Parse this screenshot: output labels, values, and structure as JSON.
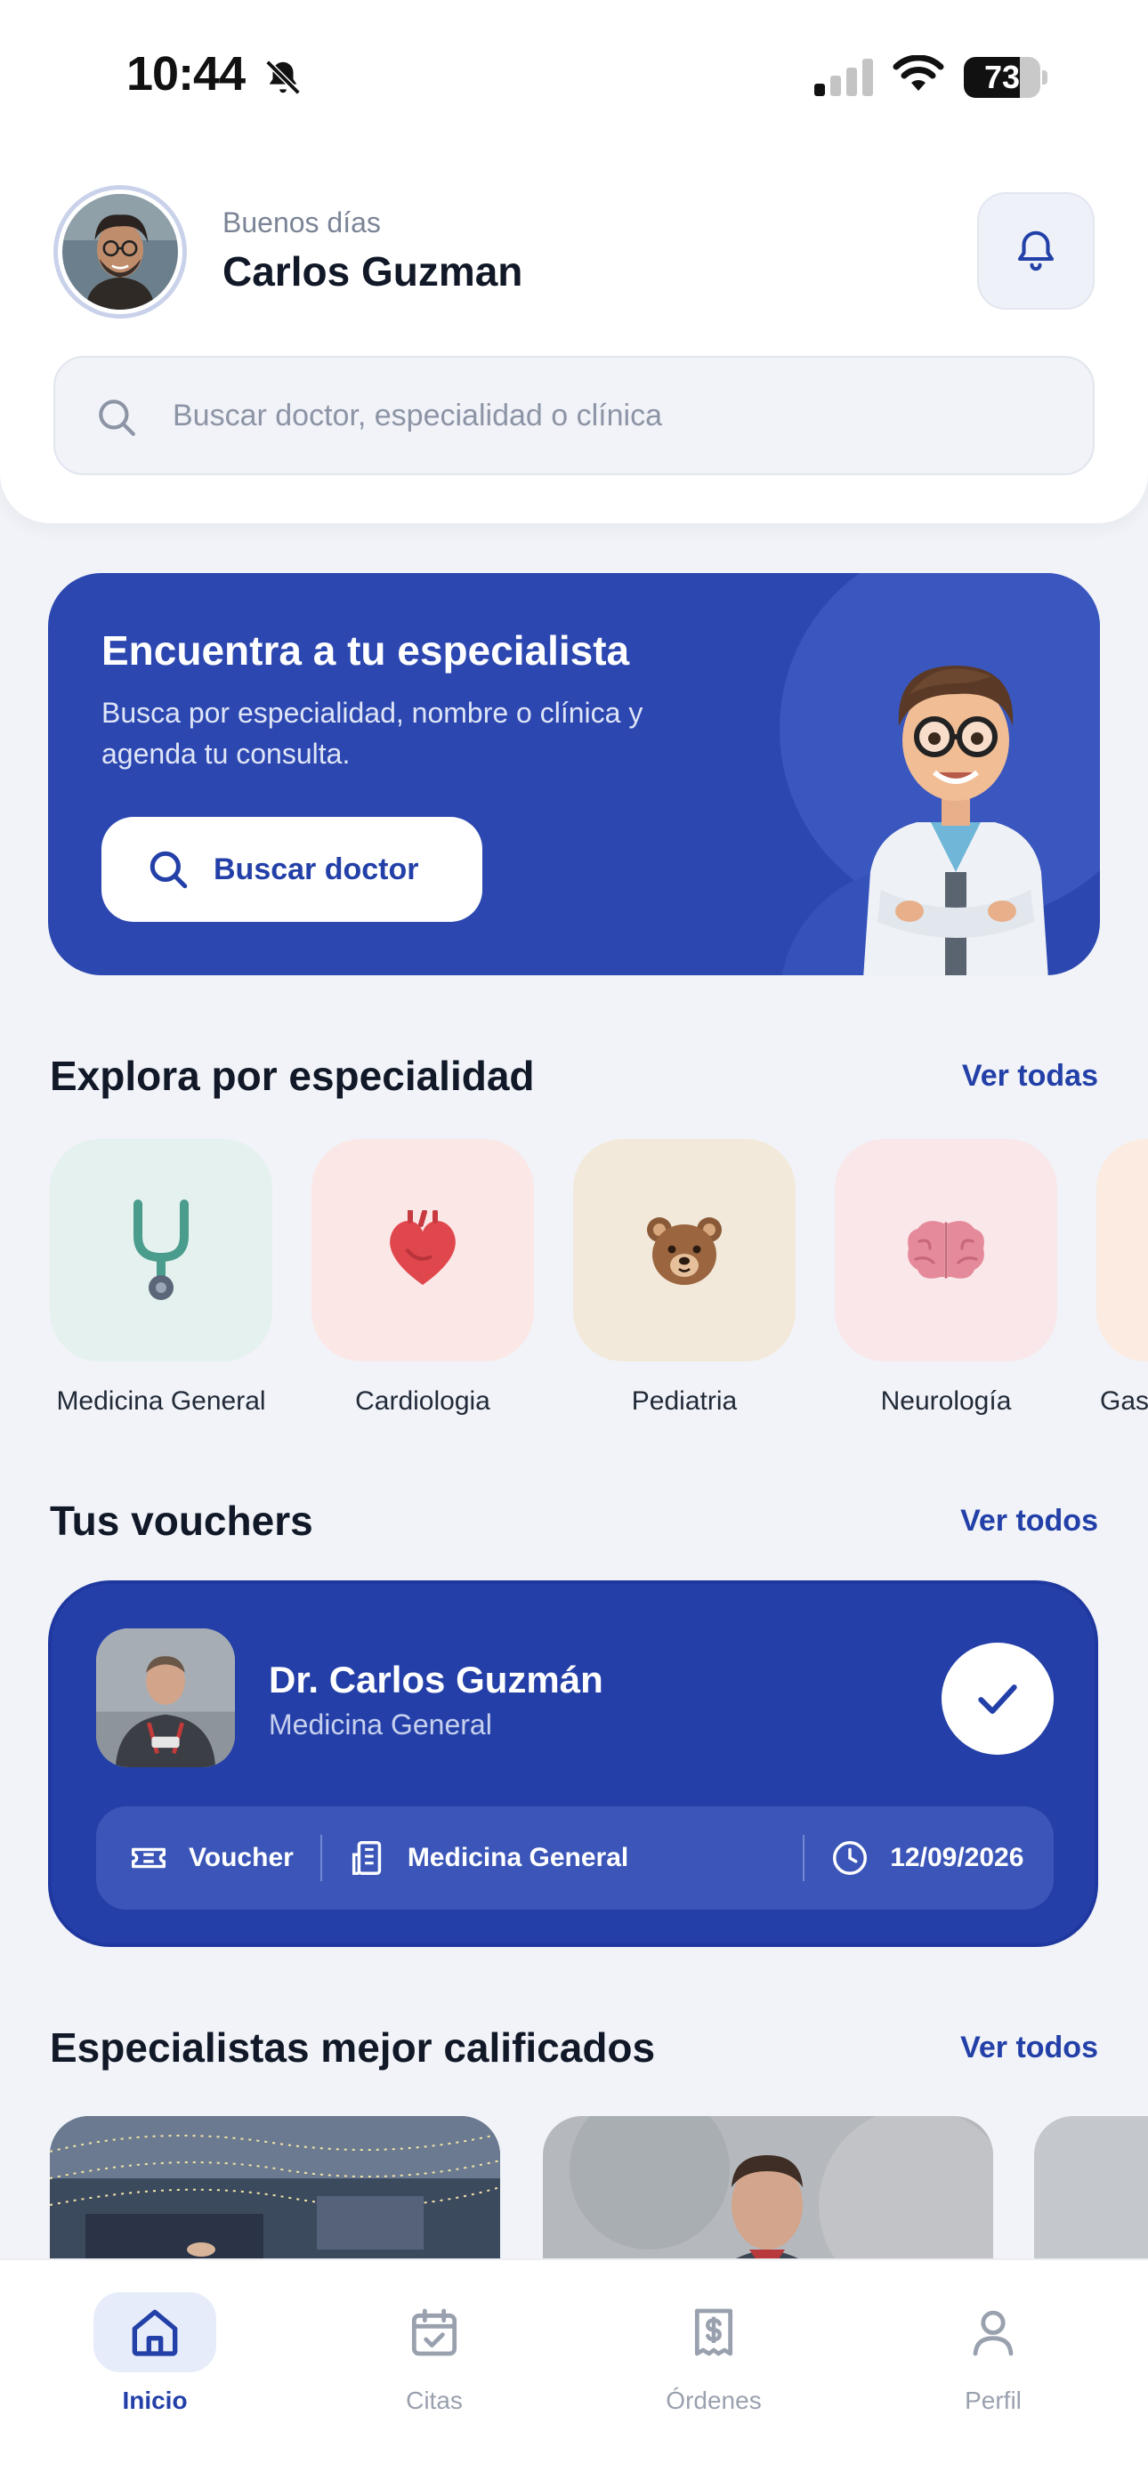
{
  "status_bar": {
    "time": "10:44",
    "battery": "73",
    "battery_level": 0.73
  },
  "header": {
    "greeting": "Buenos días",
    "user_name": "Carlos Guzman",
    "search_placeholder": "Buscar doctor, especialidad o clínica"
  },
  "hero": {
    "title": "Encuentra a tu especialista",
    "subtitle": "Busca por especialidad, nombre o clínica y agenda tu consulta.",
    "button_label": "Buscar doctor"
  },
  "specialties": {
    "title": "Explora por especialidad",
    "see_all": "Ver todas",
    "items": [
      {
        "label": "Medicina General",
        "icon": "stethoscope-icon",
        "bg": "#e4f1ee"
      },
      {
        "label": "Cardiologia",
        "icon": "heart-icon",
        "bg": "#fbe7e6"
      },
      {
        "label": "Pediatria",
        "icon": "teddy-bear-icon",
        "bg": "#f3e9da"
      },
      {
        "label": "Neurología",
        "icon": "brain-icon",
        "bg": "#f9e7ea"
      },
      {
        "label": "Gas",
        "icon": "stomach-icon",
        "bg": "#fbebe0"
      }
    ]
  },
  "vouchers": {
    "title": "Tus vouchers",
    "see_all": "Ver todos",
    "card": {
      "doctor_name": "Dr. Carlos Guzmán",
      "specialty": "Medicina General",
      "type": "Voucher",
      "department": "Medicina General",
      "date": "12/09/2026"
    }
  },
  "top_specialists": {
    "title": "Especialistas mejor calificados",
    "see_all": "Ver todos"
  },
  "bottom_nav": {
    "items": [
      {
        "label": "Inicio",
        "icon": "home-icon",
        "active": true
      },
      {
        "label": "Citas",
        "icon": "calendar-check-icon",
        "active": false
      },
      {
        "label": "Órdenes",
        "icon": "receipt-icon",
        "active": false
      },
      {
        "label": "Perfil",
        "icon": "person-icon",
        "active": false
      }
    ]
  },
  "colors": {
    "primary": "#2340a8",
    "hero_bg": "#2c47b0",
    "page_bg": "#f1f3f8"
  }
}
